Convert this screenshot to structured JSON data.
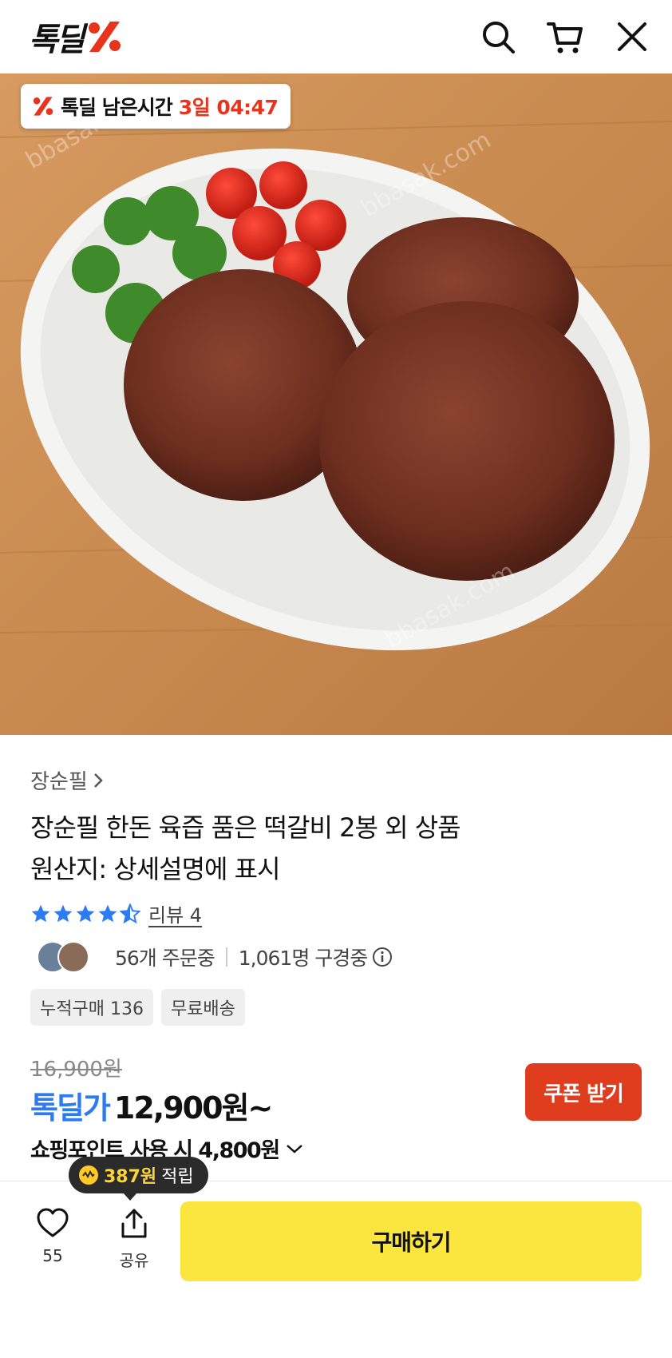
{
  "header": {
    "logo_text": "톡딜",
    "icons": [
      "search-icon",
      "cart-icon",
      "close-icon"
    ]
  },
  "hero": {
    "timer_label": "톡딜 남은시간",
    "timer_value": "3일 04:47",
    "watermark": "bbasak.com"
  },
  "product": {
    "brand": "장순필",
    "title_line1": "장순필 한돈 육즙 품은 떡갈비 2봉 외 상품",
    "title_line2": "원산지: 상세설명에 표시",
    "rating": 4.5,
    "review_label": "리뷰 4",
    "orders_text": "56개 주문중",
    "viewers_text": "1,061명 구경중",
    "tags": [
      "누적구매 136",
      "무료배송"
    ]
  },
  "price": {
    "original": "16,900원",
    "deal_label": "톡딜가",
    "deal_price": "12,900원~",
    "coupon_label": "쿠폰 받기",
    "points_text": "쇼핑포인트 사용 시 4,800원"
  },
  "bottom": {
    "tooltip_amount": "387원",
    "tooltip_suffix": "적립",
    "like_count": "55",
    "share_label": "공유",
    "buy_label": "구매하기"
  },
  "colors": {
    "accent_red": "#e8341c",
    "accent_blue": "#2d7bf0",
    "buy_yellow": "#fbe53f",
    "coupon_red": "#e03c1e"
  }
}
